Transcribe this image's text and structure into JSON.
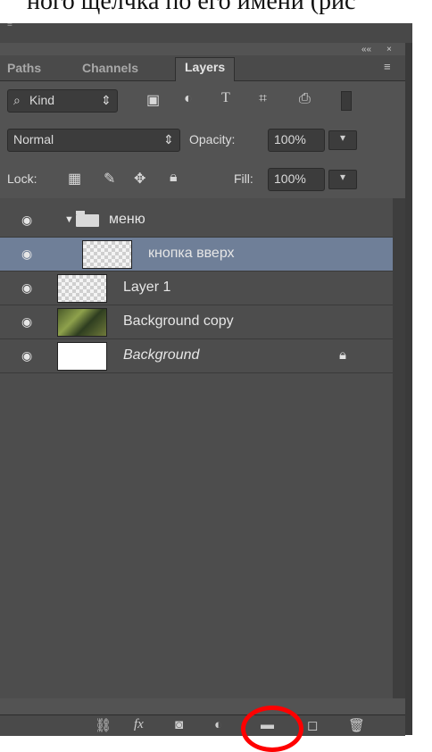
{
  "caption": {
    "text": "ного щелчка по его имени (рис"
  },
  "window": {
    "collapse_glyph": "««",
    "close_glyph": "×"
  },
  "tabs": [
    {
      "label": "Paths"
    },
    {
      "label": "Channels"
    },
    {
      "label": "Layers"
    }
  ],
  "panel_menu_glyph": "≡",
  "filter": {
    "label": "Kind"
  },
  "blend": {
    "mode": "Normal",
    "opacity_label": "Opacity:",
    "opacity_value": "100%"
  },
  "lock": {
    "label": "Lock:",
    "fill_label": "Fill:",
    "fill_value": "100%"
  },
  "layers": [
    {
      "name": "меню"
    },
    {
      "name": "кнопка вверх"
    },
    {
      "name": "Layer 1"
    },
    {
      "name": "Background copy"
    },
    {
      "name": "Background"
    }
  ],
  "colors": {
    "accent_selected": "#6f7f98",
    "highlight_circle": "#ff0000",
    "panel_bg": "#535353"
  }
}
